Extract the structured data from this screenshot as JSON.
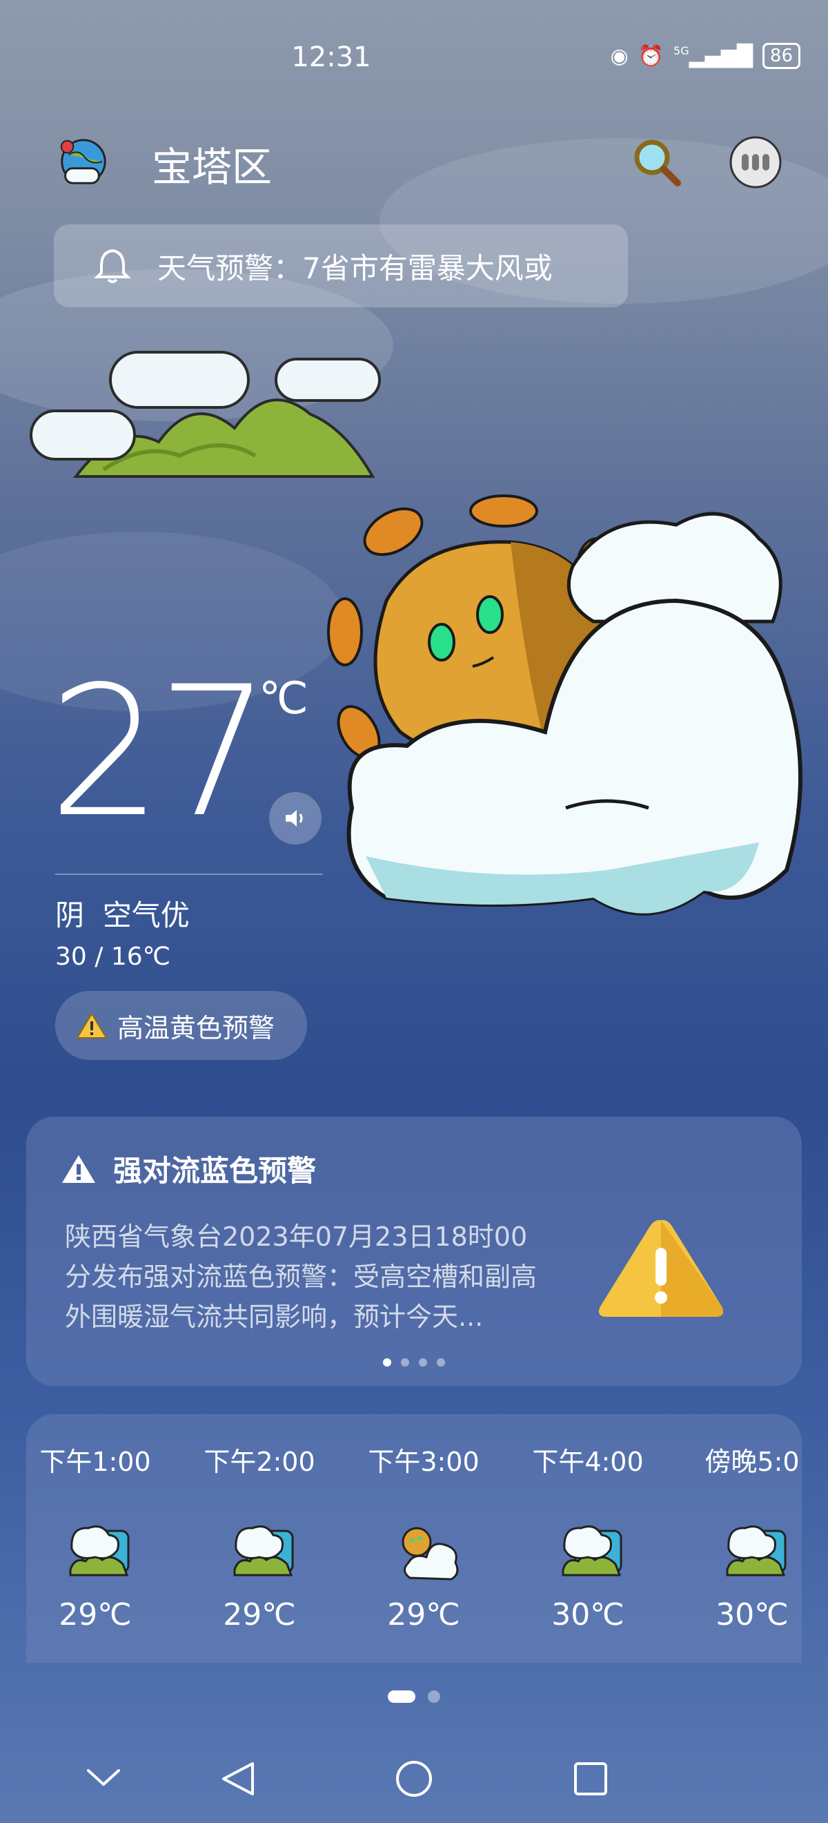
{
  "status_bar": {
    "time": "12:31",
    "signal": "5G",
    "battery": "86"
  },
  "header": {
    "city": "宝塔区"
  },
  "ticker": {
    "text": "天气预警：7省市有雷暴大风或"
  },
  "current": {
    "temp": "27",
    "unit": "℃",
    "condition": "阴  空气优",
    "range": "30 / 16℃",
    "warning_chip": "高温黄色预警"
  },
  "alert": {
    "title": "强对流蓝色预警",
    "body": "陕西省气象台2023年07月23日18时00分发布强对流蓝色预警：受高空槽和副高外围暖湿气流共同影响，预计今天...",
    "page_count": 4,
    "active_page": 1
  },
  "hourly": [
    {
      "time": "下午1:00",
      "temp": "29℃",
      "icon": "cloudy-mountain-icon"
    },
    {
      "time": "下午2:00",
      "temp": "29℃",
      "icon": "cloudy-mountain-icon"
    },
    {
      "time": "下午3:00",
      "temp": "29℃",
      "icon": "sun-cloud-icon"
    },
    {
      "time": "下午4:00",
      "temp": "30℃",
      "icon": "cloudy-mountain-icon"
    },
    {
      "time": "傍晚5:0",
      "temp": "30℃",
      "icon": "cloudy-mountain-icon"
    }
  ],
  "colors": {
    "alert_yellow": "#f5c542",
    "sun_orange": "#e2a032",
    "cloud_white": "#f4fbfd"
  }
}
